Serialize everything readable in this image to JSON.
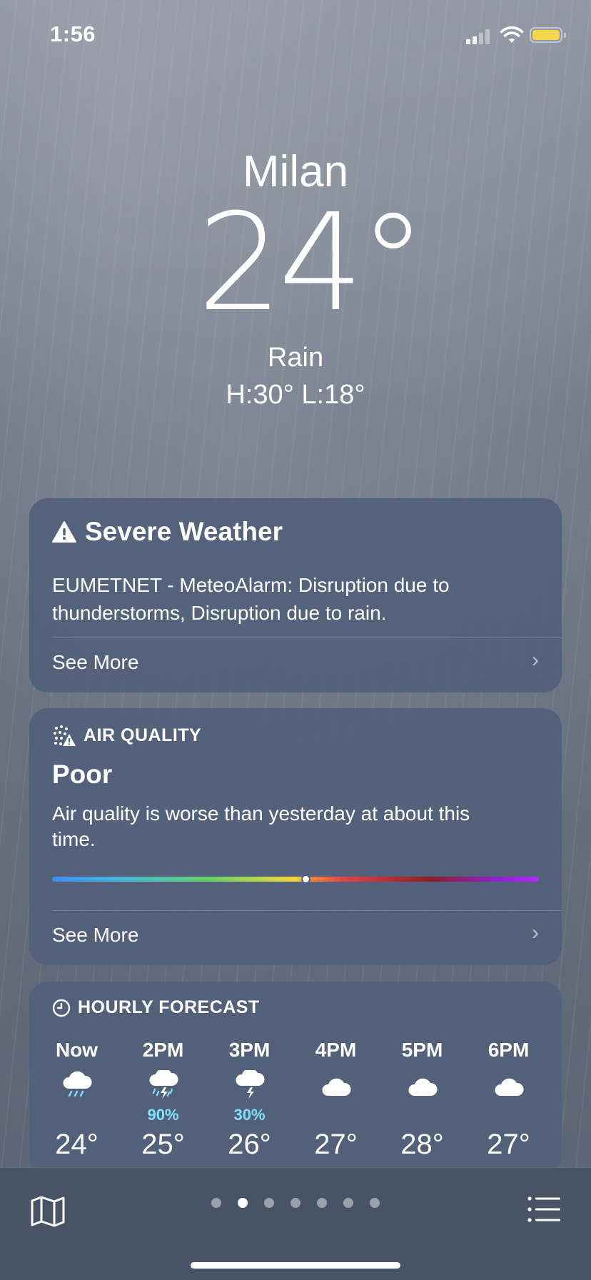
{
  "status_bar": {
    "time": "1:56",
    "signal_icon": "cellular-signal-icon",
    "wifi_icon": "wifi-icon",
    "battery_icon": "battery-icon",
    "battery_color": "#f4d54b"
  },
  "location": {
    "city": "Milan",
    "temperature": "24°",
    "condition": "Rain",
    "high_low": "H:30°  L:18°"
  },
  "severe_weather": {
    "title": "Severe Weather",
    "icon": "warning-icon",
    "text": "EUMETNET - MeteoAlarm: Disruption due to thunderstorms, Disruption due to rain.",
    "see_more": "See More"
  },
  "air_quality": {
    "label": "AIR QUALITY",
    "icon": "air-quality-icon",
    "value": "Poor",
    "text": "Air quality is worse than yesterday at about this time.",
    "indicator_fraction": 0.52,
    "see_more": "See More"
  },
  "hourly": {
    "label": "HOURLY FORECAST",
    "icon": "clock-icon",
    "hours": [
      {
        "label": "Now",
        "icon": "rain-cloud-icon",
        "pop": "",
        "temp": "24°"
      },
      {
        "label": "2PM",
        "icon": "thunderstorm-rain-icon",
        "pop": "90%",
        "temp": "25°"
      },
      {
        "label": "3PM",
        "icon": "thunderstorm-icon",
        "pop": "30%",
        "temp": "26°"
      },
      {
        "label": "4PM",
        "icon": "cloud-icon",
        "pop": "",
        "temp": "27°"
      },
      {
        "label": "5PM",
        "icon": "cloud-icon",
        "pop": "",
        "temp": "28°"
      },
      {
        "label": "6PM",
        "icon": "cloud-icon",
        "pop": "",
        "temp": "27°"
      }
    ]
  },
  "bottom_bar": {
    "map_icon": "map-icon",
    "list_icon": "list-icon",
    "page_count": 7,
    "active_page": 2
  }
}
